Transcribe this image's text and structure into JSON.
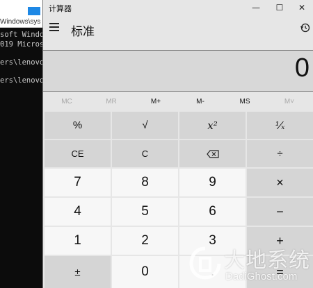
{
  "console": {
    "title_fragment": "Windows\\sys",
    "lines": [
      "soft Windo",
      "019 Micros",
      "ers\\lenovo",
      "ers\\lenovo"
    ]
  },
  "calculator": {
    "window_title": "计算器",
    "window_controls": {
      "minimize": "—",
      "maximize": "☐",
      "close": "✕"
    },
    "mode_title": "标准",
    "display_value": "0",
    "memory_buttons": [
      {
        "label": "MC",
        "enabled": false
      },
      {
        "label": "MR",
        "enabled": false
      },
      {
        "label": "M+",
        "enabled": true
      },
      {
        "label": "M-",
        "enabled": true
      },
      {
        "label": "MS",
        "enabled": true
      },
      {
        "label": "M˅",
        "enabled": false
      }
    ],
    "keys": [
      [
        "%",
        "√",
        "x²",
        "¹⁄ₓ"
      ],
      [
        "CE",
        "C",
        "backspace",
        "÷"
      ],
      [
        "7",
        "8",
        "9",
        "×"
      ],
      [
        "4",
        "5",
        "6",
        "−"
      ],
      [
        "1",
        "2",
        "3",
        "+"
      ],
      [
        "±",
        "0",
        ".",
        "="
      ]
    ]
  },
  "watermark": {
    "chinese": "大地系统",
    "english": "DadiGhost.com"
  },
  "colors": {
    "calc_bg": "#e6e6e6",
    "op_key": "#d5d5d5",
    "num_key": "#f7f7f7",
    "console_bg": "#0c0c0c"
  }
}
